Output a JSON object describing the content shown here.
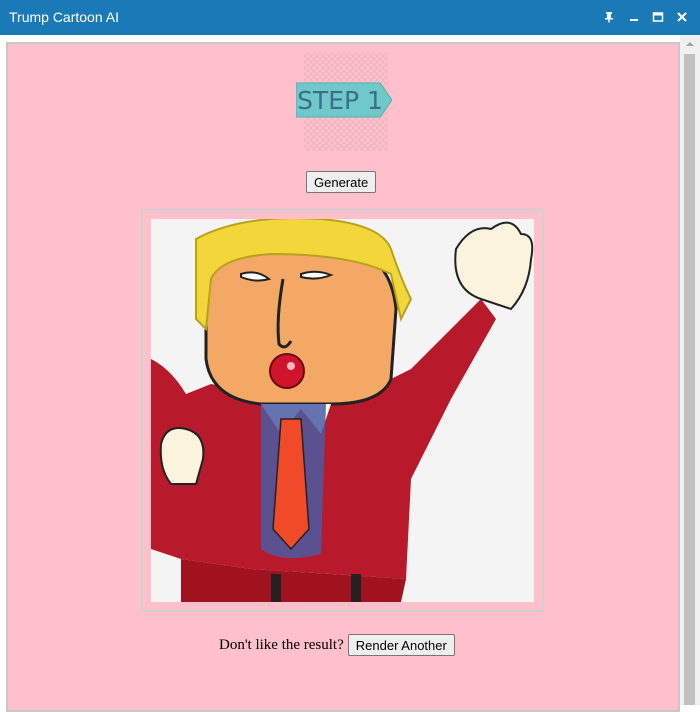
{
  "window": {
    "title": "Trump Cartoon AI",
    "titlebar_color": "#1a7ab6",
    "controls": [
      "pin-icon",
      "minimize-icon",
      "maximize-icon",
      "close-icon"
    ]
  },
  "page": {
    "background": "#ffc0cb",
    "step_banner": {
      "text": "STEP 1",
      "color": "#5bc4c4"
    },
    "generate_label": "Generate",
    "result_image": {
      "description_icon": "cartoon-portrait-image"
    },
    "retry_prompt": "Don't like the result?",
    "render_another_label": "Render Another"
  }
}
